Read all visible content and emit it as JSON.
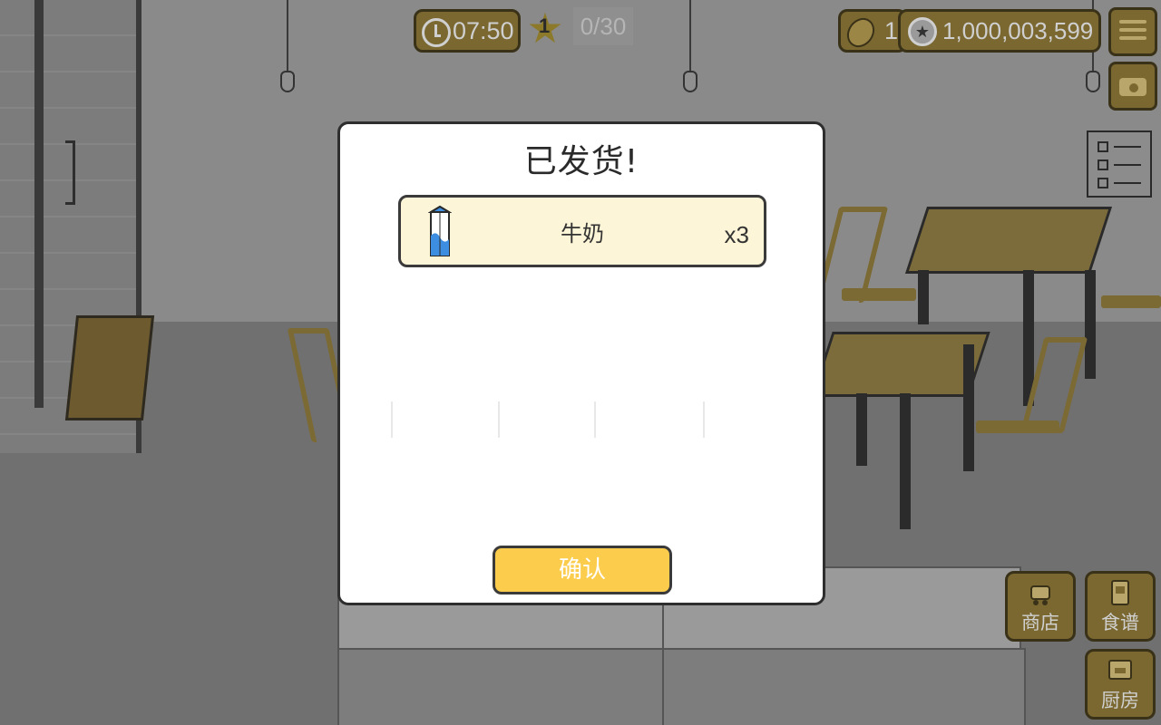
{
  "hud": {
    "timer": "07:50",
    "star_level": "1",
    "progress": "0/30",
    "beans": "1",
    "coins": "1,000,003,599"
  },
  "icons": {
    "menu": "hamburger-menu-icon",
    "camera": "camera-icon",
    "checklist": "checklist-icon",
    "clock": "clock-icon",
    "star": "star-icon",
    "bean": "coffee-bean-icon",
    "coin": "coin-icon",
    "milk": "milk-carton-icon"
  },
  "side_buttons": {
    "shop": "商店",
    "recipe": "食谱",
    "kitchen": "厨房"
  },
  "modal": {
    "title": "已发货!",
    "items": [
      {
        "name": "牛奶",
        "quantity": "x3",
        "icon": "milk-carton-icon"
      }
    ],
    "confirm": "确认"
  },
  "colors": {
    "button_yellow": "#fccd4d",
    "item_row_bg": "#fdf5d7",
    "hud_gold": "#7a6830"
  }
}
